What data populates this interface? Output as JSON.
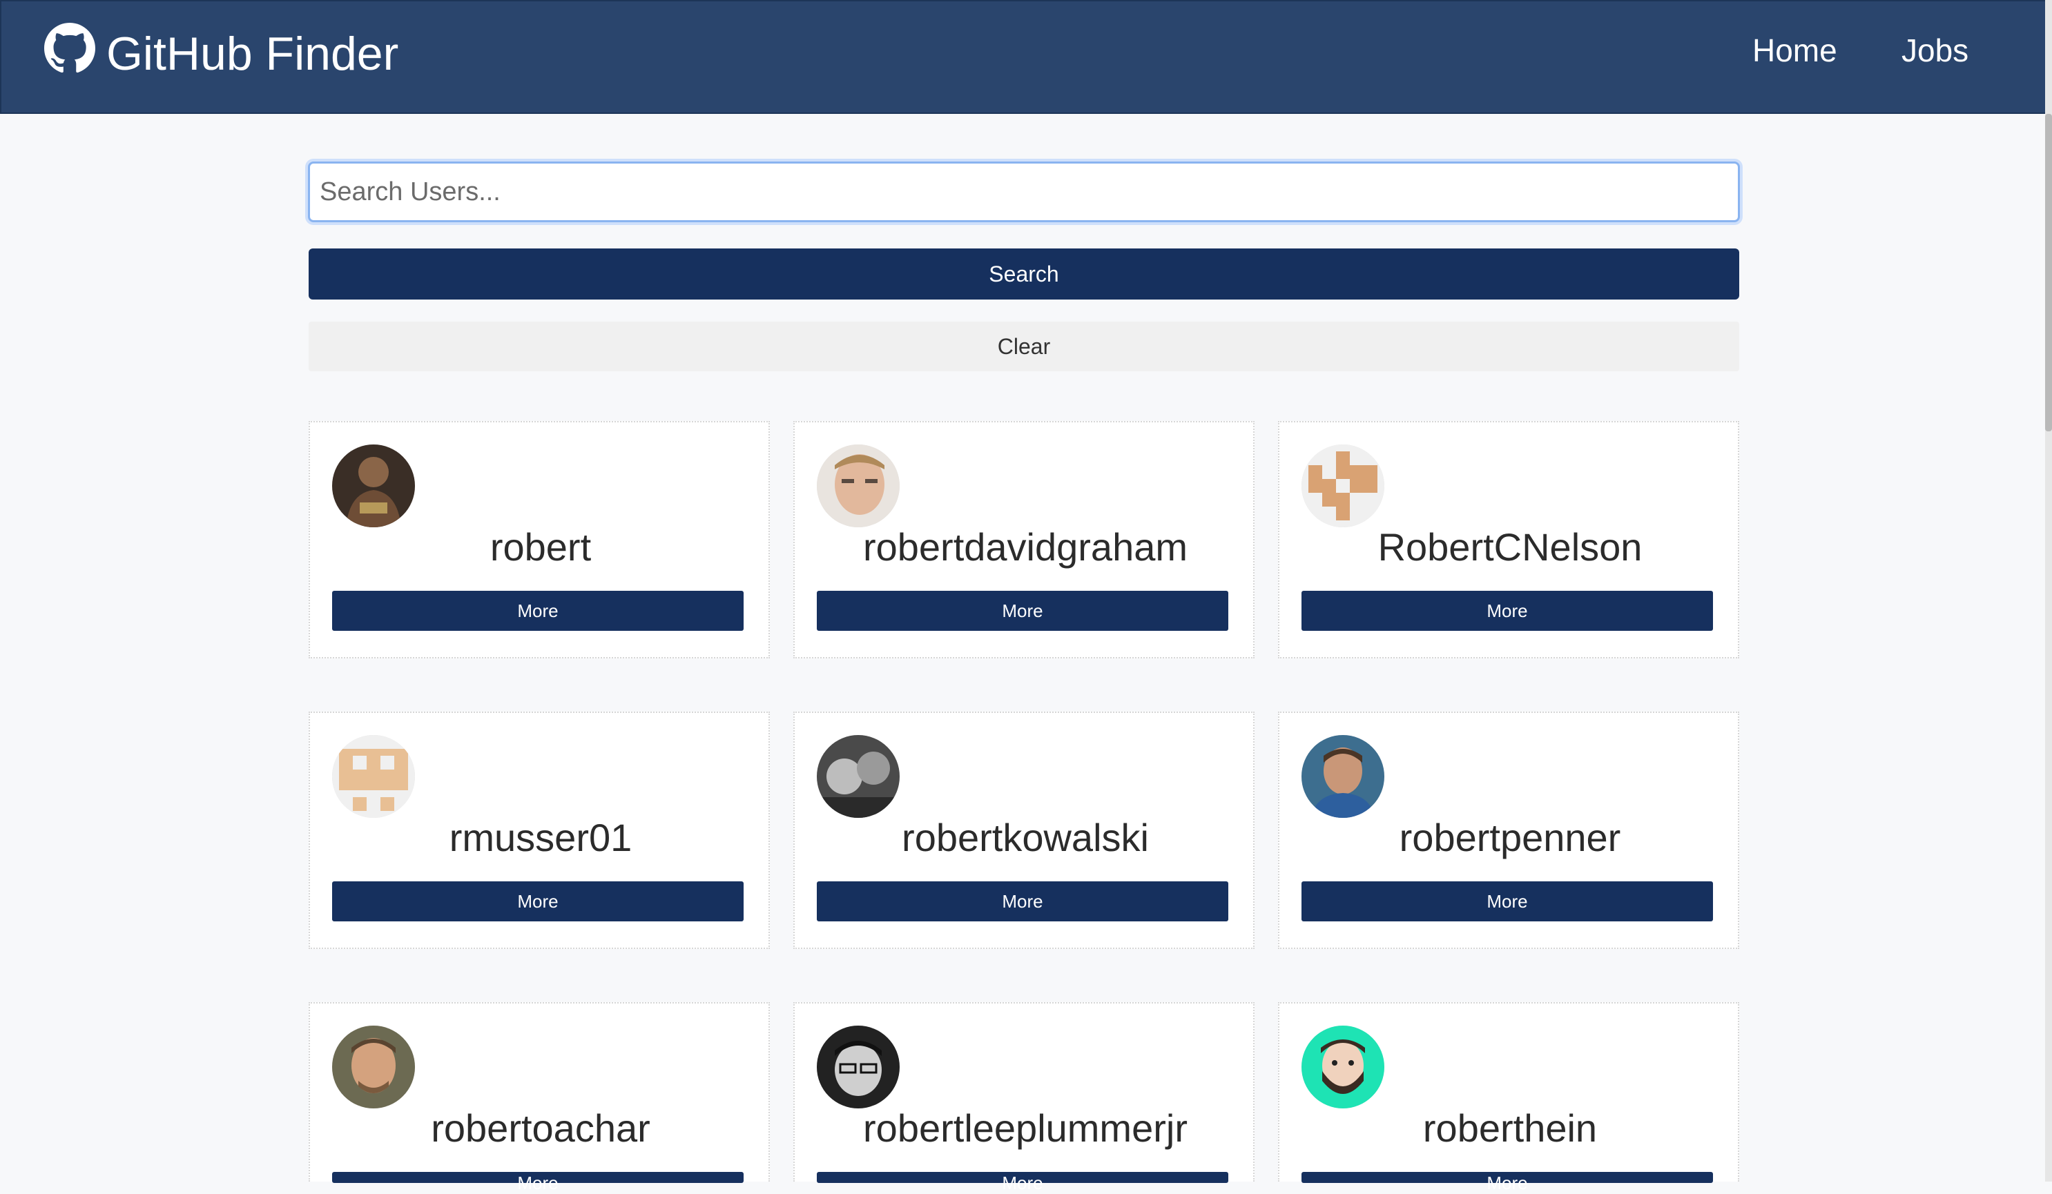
{
  "navbar": {
    "brand_icon": "github-icon",
    "brand_title": "GitHub Finder",
    "links": [
      {
        "label": "Home"
      },
      {
        "label": "Jobs"
      }
    ]
  },
  "search": {
    "placeholder": "Search Users...",
    "value": "",
    "search_label": "Search",
    "clear_label": "Clear"
  },
  "users": [
    {
      "login": "robert",
      "more_label": "More",
      "avatar": "photo"
    },
    {
      "login": "robertdavidgraham",
      "more_label": "More",
      "avatar": "photo"
    },
    {
      "login": "RobertCNelson",
      "more_label": "More",
      "avatar": "identicon",
      "avatar_color": "#d9a273"
    },
    {
      "login": "rmusser01",
      "more_label": "More",
      "avatar": "identicon",
      "avatar_color": "#e8bf94"
    },
    {
      "login": "robertkowalski",
      "more_label": "More",
      "avatar": "photo"
    },
    {
      "login": "robertpenner",
      "more_label": "More",
      "avatar": "photo"
    },
    {
      "login": "robertoachar",
      "more_label": "More",
      "avatar": "photo"
    },
    {
      "login": "robertleeplummerjr",
      "more_label": "More",
      "avatar": "photo"
    },
    {
      "login": "roberthein",
      "more_label": "More",
      "avatar": "illustration",
      "avatar_color": "#1ee3b4"
    }
  ],
  "colors": {
    "navbar_bg": "#2a456d",
    "primary_button": "#16305e",
    "clear_button": "#f0f0f0",
    "page_bg": "#f7f8fa"
  }
}
